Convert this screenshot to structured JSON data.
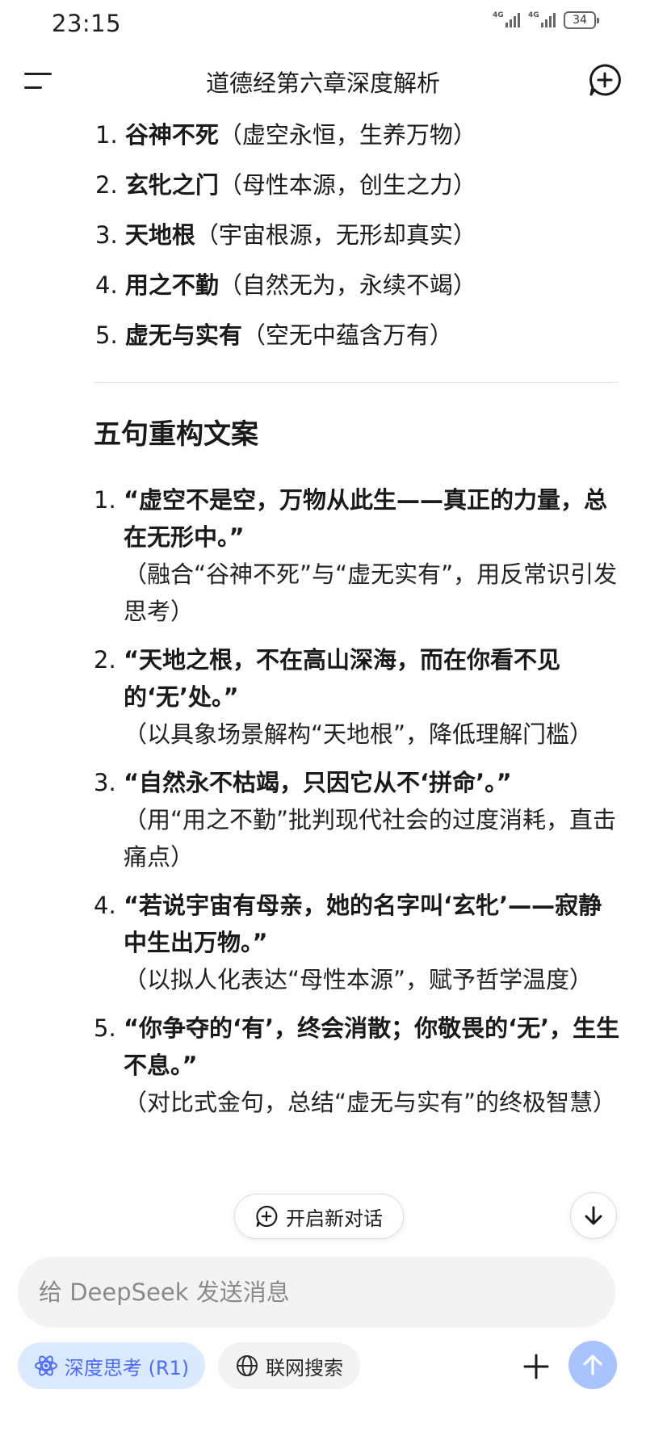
{
  "status_bar": {
    "time": "23:15",
    "network_1": "4G",
    "network_2": "4G",
    "battery": "34"
  },
  "header": {
    "title": "道德经第六章深度解析"
  },
  "concepts": {
    "items": [
      {
        "num": "1.",
        "term": "谷神不死",
        "desc": "（虚空永恒，生养万物）"
      },
      {
        "num": "2.",
        "term": "玄牝之门",
        "desc": "（母性本源，创生之力）"
      },
      {
        "num": "3.",
        "term": "天地根",
        "desc": "（宇宙根源，无形却真实）"
      },
      {
        "num": "4.",
        "term": "用之不勤",
        "desc": "（自然无为，永续不竭）"
      },
      {
        "num": "5.",
        "term": "虚无与实有",
        "desc": "（空无中蕴含万有）"
      }
    ]
  },
  "section": {
    "title": "五句重构文案"
  },
  "rewrites": {
    "items": [
      {
        "num": "1.",
        "quote": "“虚空不是空，万物从此生——真正的力量，总在无形中。”",
        "note": "（融合“谷神不死”与“虚无实有”，用反常识引发思考）"
      },
      {
        "num": "2.",
        "quote": "“天地之根，不在高山深海，而在你看不见的‘无’处。”",
        "note": "（以具象场景解构“天地根”，降低理解门槛）"
      },
      {
        "num": "3.",
        "quote": "“自然永不枯竭，只因它从不‘拼命’。”",
        "note": "（用“用之不勤”批判现代社会的过度消耗，直击痛点）"
      },
      {
        "num": "4.",
        "quote": "“若说宇宙有母亲，她的名字叫‘玄牝’——寂静中生出万物。”",
        "note": "（以拟人化表达“母性本源”，赋予哲学温度）"
      },
      {
        "num": "5.",
        "quote": "“你争夺的‘有’，终会消散；你敬畏的‘无’，生生不息。”",
        "note": "（对比式金句，总结“虚无与实有”的终极智慧）"
      }
    ]
  },
  "floating": {
    "new_chat_label": "开启新对话"
  },
  "composer": {
    "placeholder": "给 DeepSeek 发送消息",
    "deep_think_label": "深度思考 (R1)",
    "web_search_label": "联网搜索"
  },
  "colors": {
    "accent": "#4d6bfe",
    "deep_think_bg": "#dbeafe",
    "send_bg": "#a9c3ff"
  }
}
